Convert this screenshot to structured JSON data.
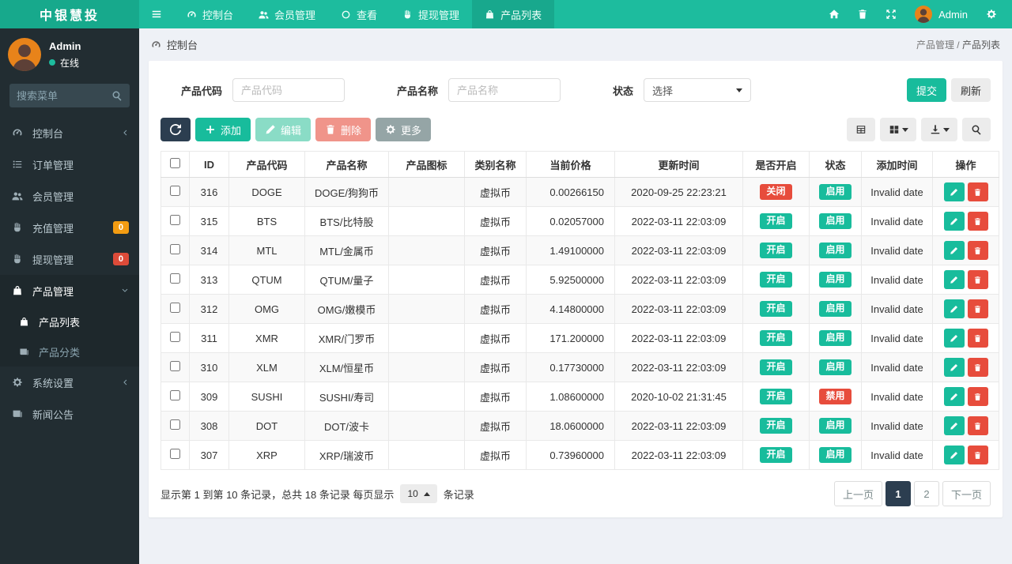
{
  "theme": {
    "navbar_green": "#1dbc9e",
    "brand_green": "#17a98c",
    "sidebar_dark": "#222d32",
    "accent_green": "#18bc9c",
    "accent_red": "#e74c3c",
    "navy": "#2c3e50",
    "badge_orange": "#f39c12",
    "badge_red": "#dd4b39",
    "page_bg": "#eef1f6"
  },
  "navbar": {
    "brand": "中银慧投",
    "items": [
      {
        "key": "dashboard",
        "icon": "dashboard",
        "label": "控制台",
        "active": false
      },
      {
        "key": "members",
        "icon": "users",
        "label": "会员管理",
        "active": false
      },
      {
        "key": "view",
        "icon": "circle",
        "label": "查看",
        "active": false
      },
      {
        "key": "withdraw",
        "icon": "hand",
        "label": "提现管理",
        "active": false
      },
      {
        "key": "product-list",
        "icon": "bag",
        "label": "产品列表",
        "active": true
      }
    ],
    "user_name": "Admin"
  },
  "sidebar": {
    "user": {
      "name": "Admin",
      "status": "在线"
    },
    "search_placeholder": "搜索菜单",
    "items": [
      {
        "key": "dashboard",
        "icon": "dashboard",
        "label": "控制台",
        "chevron": "left"
      },
      {
        "key": "orders",
        "icon": "list",
        "label": "订单管理"
      },
      {
        "key": "members",
        "icon": "users",
        "label": "会员管理"
      },
      {
        "key": "recharge",
        "icon": "hand",
        "label": "充值管理",
        "badge": "0",
        "badge_color": "#f39c12"
      },
      {
        "key": "withdraw",
        "icon": "hand",
        "label": "提现管理",
        "badge": "0",
        "badge_color": "#dd4b39"
      },
      {
        "key": "products",
        "icon": "bag",
        "label": "产品管理",
        "chevron": "down",
        "active": true,
        "children": [
          {
            "key": "product-list",
            "icon": "bag",
            "label": "产品列表",
            "active": true
          },
          {
            "key": "product-category",
            "icon": "newspaper",
            "label": "产品分类",
            "active": false
          }
        ]
      },
      {
        "key": "settings",
        "icon": "cogs",
        "label": "系统设置",
        "chevron": "left"
      },
      {
        "key": "news",
        "icon": "newspaper",
        "label": "新闻公告"
      }
    ]
  },
  "breadcrumb": {
    "left": "控制台",
    "parent": "产品管理",
    "separator": "/",
    "current": "产品列表"
  },
  "filters": {
    "code_label": "产品代码",
    "code_placeholder": "产品代码",
    "code_value": "",
    "name_label": "产品名称",
    "name_placeholder": "产品名称",
    "name_value": "",
    "status_label": "状态",
    "status_value": "选择",
    "submit_label": "提交",
    "refresh_label": "刷新"
  },
  "toolbar": {
    "add_label": "添加",
    "edit_label": "编辑",
    "delete_label": "删除",
    "more_label": "更多"
  },
  "table": {
    "columns": [
      "ID",
      "产品代码",
      "产品名称",
      "产品图标",
      "类别名称",
      "当前价格",
      "更新时间",
      "是否开启",
      "状态",
      "添加时间",
      "操作"
    ],
    "rows": [
      {
        "id": "316",
        "code": "DOGE",
        "name": "DOGE/狗狗币",
        "icon": "",
        "category": "虚拟币",
        "price": "0.00266150",
        "updated": "2020-09-25 22:23:21",
        "open_label": "关闭",
        "open_state": "off",
        "status_label": "启用",
        "status_state": "on",
        "added": "Invalid date"
      },
      {
        "id": "315",
        "code": "BTS",
        "name": "BTS/比特股",
        "icon": "",
        "category": "虚拟币",
        "price": "0.02057000",
        "updated": "2022-03-11 22:03:09",
        "open_label": "开启",
        "open_state": "on",
        "status_label": "启用",
        "status_state": "on",
        "added": "Invalid date"
      },
      {
        "id": "314",
        "code": "MTL",
        "name": "MTL/金属币",
        "icon": "",
        "category": "虚拟币",
        "price": "1.49100000",
        "updated": "2022-03-11 22:03:09",
        "open_label": "开启",
        "open_state": "on",
        "status_label": "启用",
        "status_state": "on",
        "added": "Invalid date"
      },
      {
        "id": "313",
        "code": "QTUM",
        "name": "QTUM/量子",
        "icon": "",
        "category": "虚拟币",
        "price": "5.92500000",
        "updated": "2022-03-11 22:03:09",
        "open_label": "开启",
        "open_state": "on",
        "status_label": "启用",
        "status_state": "on",
        "added": "Invalid date"
      },
      {
        "id": "312",
        "code": "OMG",
        "name": "OMG/嫩模币",
        "icon": "",
        "category": "虚拟币",
        "price": "4.14800000",
        "updated": "2022-03-11 22:03:09",
        "open_label": "开启",
        "open_state": "on",
        "status_label": "启用",
        "status_state": "on",
        "added": "Invalid date"
      },
      {
        "id": "311",
        "code": "XMR",
        "name": "XMR/门罗币",
        "icon": "",
        "category": "虚拟币",
        "price": "171.200000",
        "updated": "2022-03-11 22:03:09",
        "open_label": "开启",
        "open_state": "on",
        "status_label": "启用",
        "status_state": "on",
        "added": "Invalid date"
      },
      {
        "id": "310",
        "code": "XLM",
        "name": "XLM/恒星币",
        "icon": "",
        "category": "虚拟币",
        "price": "0.17730000",
        "updated": "2022-03-11 22:03:09",
        "open_label": "开启",
        "open_state": "on",
        "status_label": "启用",
        "status_state": "on",
        "added": "Invalid date"
      },
      {
        "id": "309",
        "code": "SUSHI",
        "name": "SUSHI/寿司",
        "icon": "",
        "category": "虚拟币",
        "price": "1.08600000",
        "updated": "2020-10-02 21:31:45",
        "open_label": "开启",
        "open_state": "on",
        "status_label": "禁用",
        "status_state": "off",
        "added": "Invalid date"
      },
      {
        "id": "308",
        "code": "DOT",
        "name": "DOT/波卡",
        "icon": "",
        "category": "虚拟币",
        "price": "18.0600000",
        "updated": "2022-03-11 22:03:09",
        "open_label": "开启",
        "open_state": "on",
        "status_label": "启用",
        "status_state": "on",
        "added": "Invalid date"
      },
      {
        "id": "307",
        "code": "XRP",
        "name": "XRP/瑞波币",
        "icon": "",
        "category": "虚拟币",
        "price": "0.73960000",
        "updated": "2022-03-11 22:03:09",
        "open_label": "开启",
        "open_state": "on",
        "status_label": "启用",
        "status_state": "on",
        "added": "Invalid date"
      }
    ]
  },
  "pagination": {
    "info_before": "显示第 1 到第 10 条记录，总共 18 条记录 每页显示",
    "page_size": "10",
    "info_after": "条记录",
    "prev_label": "上一页",
    "next_label": "下一页",
    "pages": [
      "1",
      "2"
    ],
    "active_page": "1"
  }
}
